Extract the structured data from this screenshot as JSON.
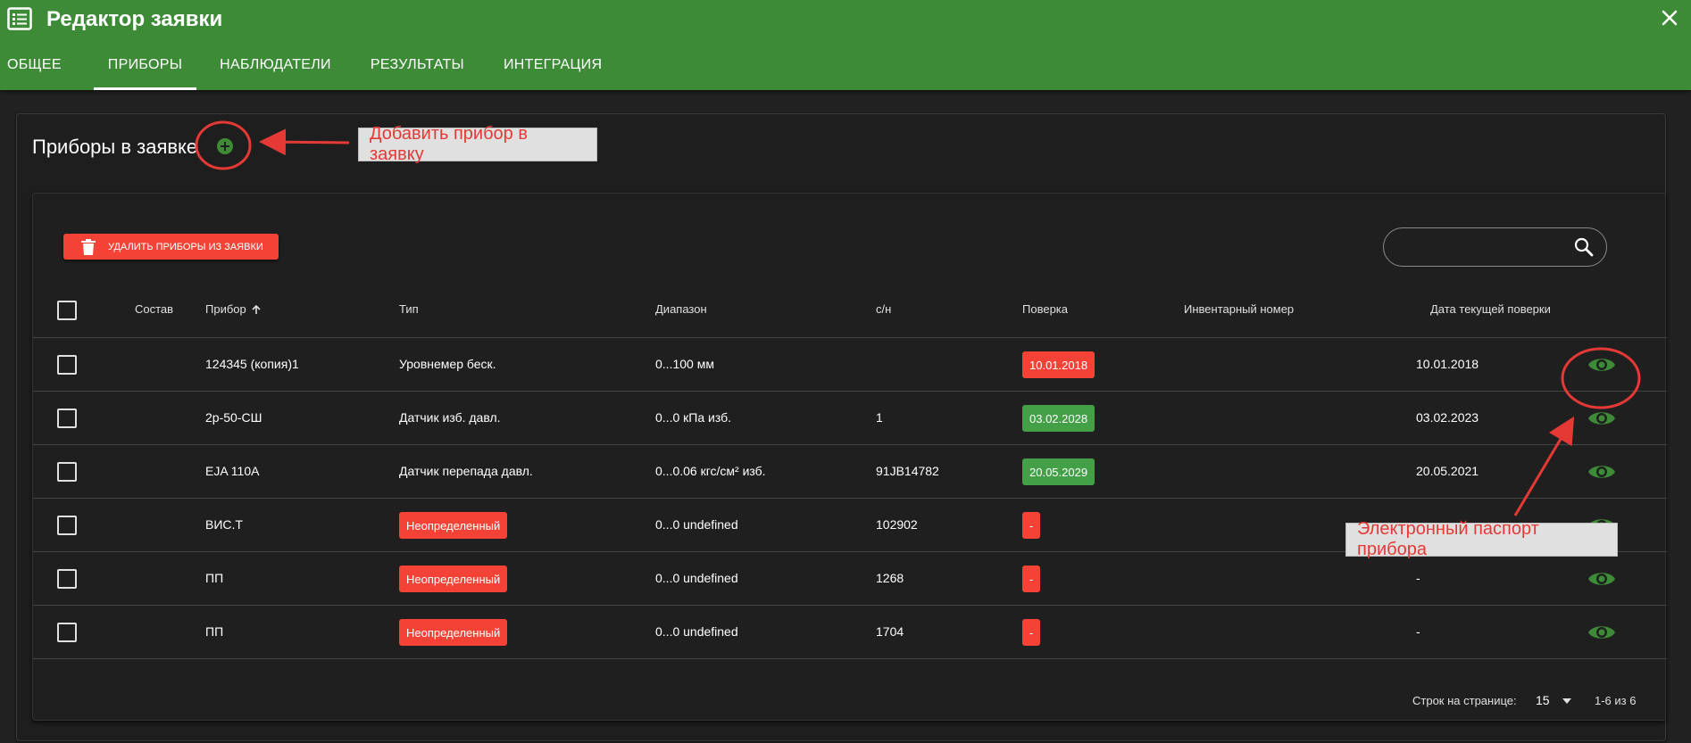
{
  "app": {
    "title": "Редактор заявки",
    "icon": "list-icon",
    "close_icon": "close-icon"
  },
  "tabs": [
    {
      "label": "ОБЩЕЕ",
      "active": false
    },
    {
      "label": "ПРИБОРЫ",
      "active": true
    },
    {
      "label": "НАБЛЮДАТЕЛИ",
      "active": false
    },
    {
      "label": "РЕЗУЛЬТАТЫ",
      "active": false
    },
    {
      "label": "ИНТЕГРАЦИЯ",
      "active": false
    }
  ],
  "section": {
    "title": "Приборы в заявке",
    "add_icon": "add-circle-icon"
  },
  "toolbar": {
    "delete_label": "УДАЛИТЬ ПРИБОРЫ ИЗ ЗАЯВКИ",
    "delete_icon": "trash-icon",
    "search_placeholder": "",
    "search_value": "",
    "search_icon": "search-icon"
  },
  "table": {
    "headers": {
      "composition": "Состав",
      "device": "Прибор",
      "type": "Тип",
      "range": "Диапазон",
      "serial": "с/н",
      "verification": "Поверка",
      "inventory": "Инвентарный номер",
      "current_verification_date": "Дата текущей поверки"
    },
    "sort": {
      "column": "device",
      "direction": "asc",
      "icon": "arrow-up-icon"
    },
    "rows": [
      {
        "device": "124345 (копия)1",
        "type": "Уровнемер беск.",
        "type_badge": false,
        "range": "0...100 мм",
        "serial": "",
        "verification": "10.01.2018",
        "verification_status": "red",
        "inventory": "",
        "current_date": "10.01.2018"
      },
      {
        "device": "2р-50-СШ",
        "type": "Датчик изб. давл.",
        "type_badge": false,
        "range": "0...0 кПа изб.",
        "serial": "1",
        "verification": "03.02.2028",
        "verification_status": "green",
        "inventory": "",
        "current_date": "03.02.2023"
      },
      {
        "device": "EJA 110A",
        "type": "Датчик перепада давл.",
        "type_badge": false,
        "range": "0...0.06 кгс/см² изб.",
        "serial": "91JB14782",
        "verification": "20.05.2029",
        "verification_status": "green",
        "inventory": "",
        "current_date": "20.05.2021"
      },
      {
        "device": "ВИС.Т",
        "type": "Неопределенный",
        "type_badge": true,
        "range": "0...0 undefined",
        "serial": "102902",
        "verification": "-",
        "verification_status": "red",
        "inventory": "",
        "current_date": ""
      },
      {
        "device": "ПП",
        "type": "Неопределенный",
        "type_badge": true,
        "range": "0...0 undefined",
        "serial": "1268",
        "verification": "-",
        "verification_status": "red",
        "inventory": "",
        "current_date": "-"
      },
      {
        "device": "ПП",
        "type": "Неопределенный",
        "type_badge": true,
        "range": "0...0 undefined",
        "serial": "1704",
        "verification": "-",
        "verification_status": "red",
        "inventory": "",
        "current_date": "-"
      }
    ],
    "row_action_icon": "eye-icon"
  },
  "pagination": {
    "rows_per_page_label": "Строк на странице:",
    "rows_per_page": "15",
    "range_text": "1-6 из 6"
  },
  "annotations": {
    "add_device": "Добавить прибор в заявку",
    "passport": "Электронный паспорт прибора"
  },
  "colors": {
    "appbar": "#3d8b37",
    "background": "#212121",
    "danger": "#f44336",
    "success": "#43a047",
    "annotation": "#e53935"
  }
}
